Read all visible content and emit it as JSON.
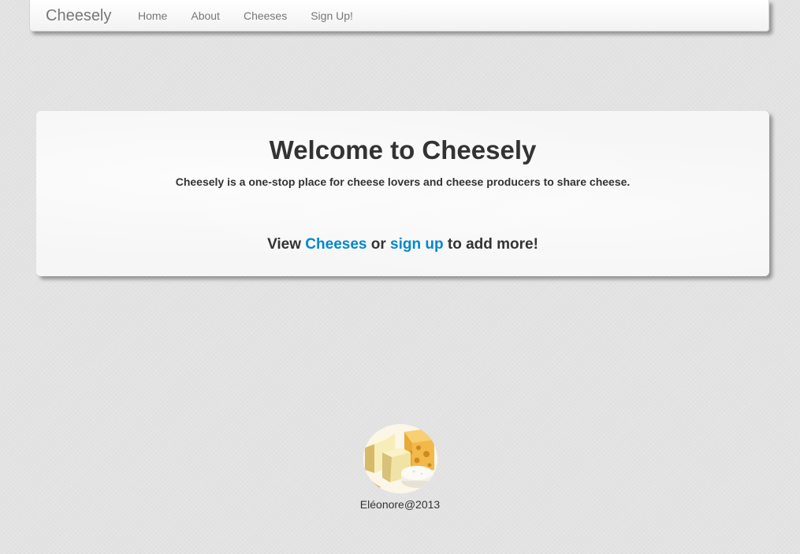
{
  "navbar": {
    "brand": "Cheesely",
    "links": [
      "Home",
      "About",
      "Cheeses",
      "Sign Up!"
    ]
  },
  "hero": {
    "title": "Welcome to Cheesely",
    "description": "Cheesely is a one-stop place for cheese lovers and cheese producers to share cheese.",
    "cta": {
      "prefix": "View ",
      "link1": "Cheeses",
      "middle": " or ",
      "link2": "sign up",
      "suffix": " to add more!"
    }
  },
  "footer": {
    "logo_icon": "cheese-logo-icon",
    "credit": "Eléonore@2013"
  },
  "colors": {
    "background": "#e3e3e3",
    "link": "#0088cc",
    "text": "#333333",
    "nav_text": "#777777"
  }
}
